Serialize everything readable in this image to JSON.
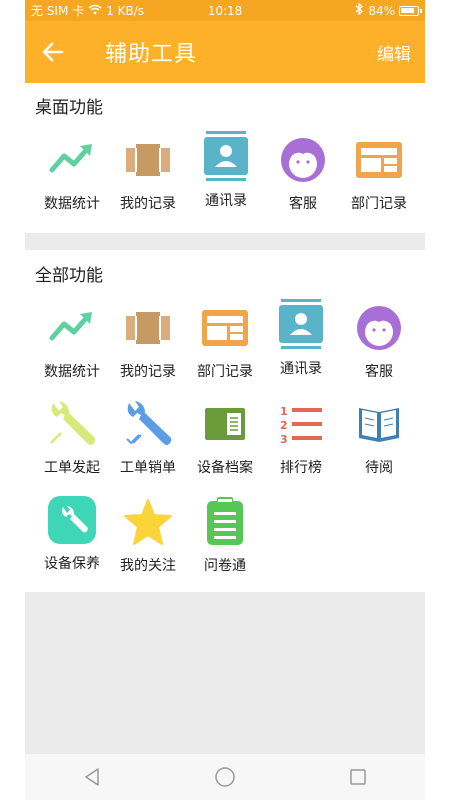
{
  "status_bar": {
    "carrier": "无 SIM 卡",
    "speed": "1 KB/s",
    "time": "10:18",
    "battery": "84%"
  },
  "app_bar": {
    "title": "辅助工具",
    "edit_label": "编辑"
  },
  "desktop": {
    "title": "桌面功能",
    "items": [
      {
        "label": "数据统计",
        "icon": "trend-chart-icon"
      },
      {
        "label": "我的记录",
        "icon": "record-book-icon"
      },
      {
        "label": "通讯录",
        "icon": "contacts-icon"
      },
      {
        "label": "客服",
        "icon": "customer-service-icon"
      },
      {
        "label": "部门记录",
        "icon": "department-record-icon"
      }
    ]
  },
  "all": {
    "title": "全部功能",
    "items": [
      {
        "label": "数据统计",
        "icon": "trend-chart-icon"
      },
      {
        "label": "我的记录",
        "icon": "record-book-icon"
      },
      {
        "label": "部门记录",
        "icon": "department-record-icon"
      },
      {
        "label": "通讯录",
        "icon": "contacts-icon"
      },
      {
        "label": "客服",
        "icon": "customer-service-icon"
      },
      {
        "label": "工单发起",
        "icon": "wrench-icon"
      },
      {
        "label": "工单销单",
        "icon": "wrench-check-icon"
      },
      {
        "label": "设备档案",
        "icon": "device-file-icon"
      },
      {
        "label": "排行榜",
        "icon": "ranking-list-icon"
      },
      {
        "label": "待阅",
        "icon": "open-book-icon"
      },
      {
        "label": "设备保养",
        "icon": "maintenance-icon"
      },
      {
        "label": "我的关注",
        "icon": "star-icon"
      },
      {
        "label": "问卷通",
        "icon": "clipboard-icon"
      }
    ]
  },
  "colors": {
    "accent": "#fdb02a",
    "status_bar": "#f5a623",
    "divider": "#ebebeb"
  }
}
